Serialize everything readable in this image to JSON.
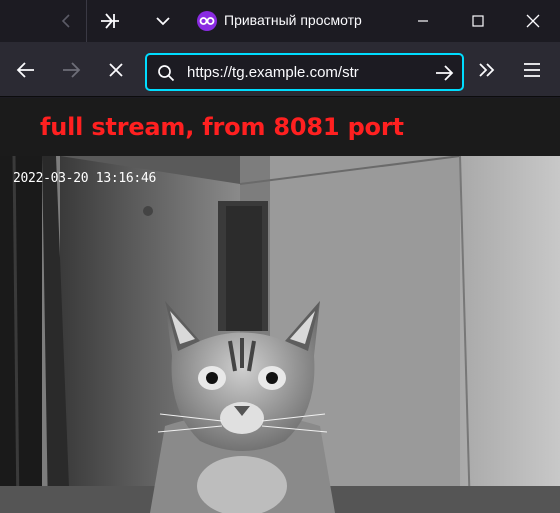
{
  "titlebar": {
    "private_label": "Приватный просмотр"
  },
  "navbar": {
    "url": "https://tg.example.com/str"
  },
  "page": {
    "headline": "full stream, from 8081 port",
    "timestamp": "2022-03-20 13:16:46"
  },
  "colors": {
    "accent_focus": "#00ddff",
    "private_purple": "#8a2be2",
    "headline_red": "#ff2020"
  }
}
